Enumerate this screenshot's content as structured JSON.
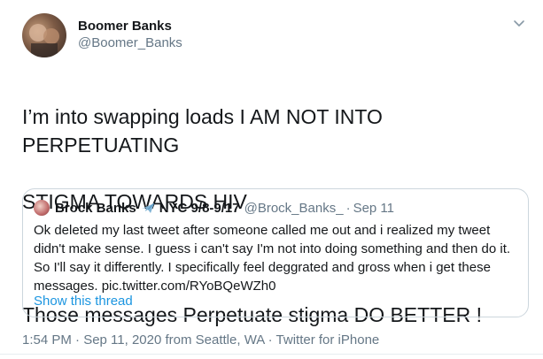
{
  "author": {
    "name": "Boomer Banks",
    "handle": "@Boomer_Banks"
  },
  "tweet": {
    "text_line1": "I’m into swapping loads I AM NOT INTO PERPETUATING",
    "text_line2": "STIGMA TOWARDS HIV",
    "text_line3": "Those messages Perpetuate stigma DO BETTER !"
  },
  "quoted": {
    "name": "Brock Banks",
    "name_rest": "NYC 9/8-9/17",
    "handle": "@Brock_Banks_",
    "separator": "·",
    "date": "Sep 11",
    "lines": [
      "Ok deleted my last tweet after someone called me out and i realized my tweet",
      "didn't make sense. I guess i can't say I'm not into doing something and then do it.",
      "So I'll say it differently. I specifically feel deggrated and gross when i get these",
      "messages. pic.twitter.com/RYoBQeWZh0"
    ],
    "show_thread": "Show this thread"
  },
  "meta": {
    "text": "1:54 PM · Sep 11, 2020 from Seattle, WA · Twitter for iPhone"
  },
  "colors": {
    "link": "#1b95e0",
    "secondary_text": "#657786",
    "border": "#ccd6dd"
  },
  "icons": {
    "caret": "chevron-down-icon",
    "plane": "airplane-icon"
  }
}
